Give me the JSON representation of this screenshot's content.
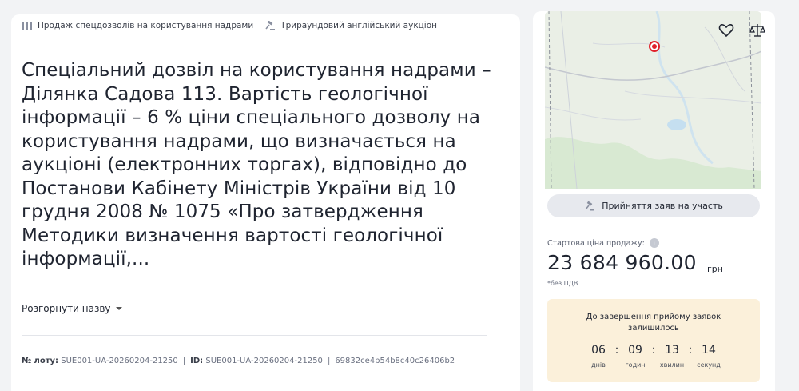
{
  "categories": [
    {
      "icon": "columns-icon",
      "label": "Продаж спецдозволів на користування надрами"
    },
    {
      "icon": "gavel-icon",
      "label": "Трираундовий англійський аукціон"
    }
  ],
  "title": "Спеціальний дозвіл на користування надрами – Ділянка Садова 113. Вартість геологічної інформації – 6 % ціни спеціального дозволу на користування надрами, що визначається на аукціоні (електронних торгах), відповідно до Постанови Кабінету Міністрів України від 10 грудня 2008 № 1075 «Про затвердження Методики визначення вартості геологічної інформації,...",
  "expand_label": "Розгорнути назву",
  "ids": {
    "lot_label": "№ лоту:",
    "lot_value": "SUE001-UA-20260204-21250",
    "id_label": "ID:",
    "id_value": "SUE001-UA-20260204-21250",
    "sep": "|",
    "hash": "69832ce4b54b8c40c26406b2"
  },
  "accept_button": "Прийняття заяв на участь",
  "price": {
    "label": "Стартова ціна продажу:",
    "value": "23 684 960.00",
    "currency": "грн",
    "vat_note": "*без ПДВ"
  },
  "timer": {
    "title_line1": "До завершення прийому заявок",
    "title_line2": "залишилось",
    "days": "06",
    "hours": "09",
    "minutes": "13",
    "seconds": "14",
    "days_label": "днів",
    "hours_label": "годин",
    "minutes_label": "хвилин",
    "seconds_label": "секунд",
    "sep": ":"
  },
  "colors": {
    "marker": "#e0202a",
    "timer_bg": "#fbf0da",
    "button_bg": "#e7e9ee"
  }
}
